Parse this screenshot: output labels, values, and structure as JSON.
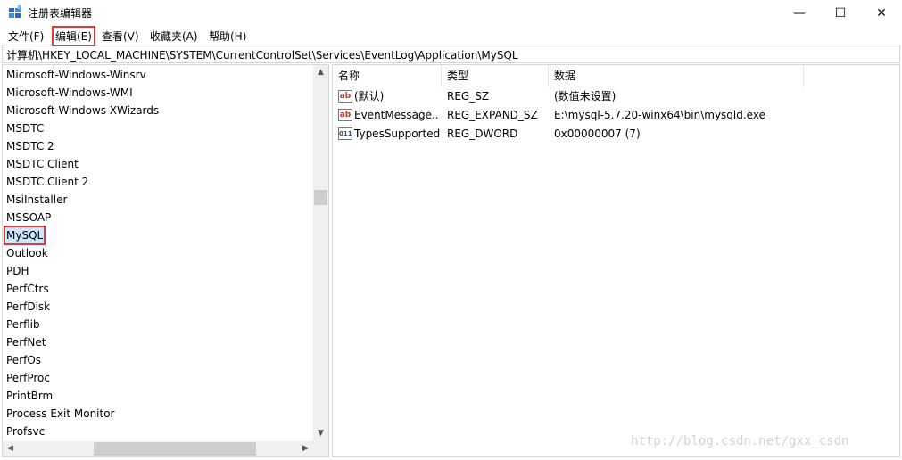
{
  "window": {
    "title": "注册表编辑器",
    "app_icon": "regedit-icon",
    "minimize_glyph": "—",
    "maximize_glyph": "☐",
    "close_glyph": "✕"
  },
  "menu": [
    "文件(F)",
    "编辑(E)",
    "查看(V)",
    "收藏夹(A)",
    "帮助(H)"
  ],
  "address": "计算机\\HKEY_LOCAL_MACHINE\\SYSTEM\\CurrentControlSet\\Services\\EventLog\\Application\\MySQL",
  "tree": {
    "items": [
      "Microsoft-Windows-Winsrv",
      "Microsoft-Windows-WMI",
      "Microsoft-Windows-XWizards",
      "MSDTC",
      "MSDTC 2",
      "MSDTC Client",
      "MSDTC Client 2",
      "MsiInstaller",
      "MSSOAP",
      "MySQL",
      "Outlook",
      "PDH",
      "PerfCtrs",
      "PerfDisk",
      "Perflib",
      "PerfNet",
      "PerfOs",
      "PerfProc",
      "PrintBrm",
      "Process Exit Monitor",
      "Profsvc"
    ],
    "selected": "MySQL"
  },
  "list": {
    "columns": [
      "名称",
      "类型",
      "数据"
    ],
    "rows": [
      {
        "icon": "string-value-icon",
        "icon_text": "ab",
        "name": "(默认)",
        "type": "REG_SZ",
        "data": "(数值未设置)"
      },
      {
        "icon": "string-value-icon",
        "icon_text": "ab",
        "name": "EventMessage...",
        "type": "REG_EXPAND_SZ",
        "data": "E:\\mysql-5.7.20-winx64\\bin\\mysqld.exe"
      },
      {
        "icon": "binary-value-icon",
        "icon_text": "011",
        "name": "TypesSupported",
        "type": "REG_DWORD",
        "data": "0x00000007 (7)"
      }
    ]
  },
  "watermark": "http://blog.csdn.net/gxx_csdn"
}
